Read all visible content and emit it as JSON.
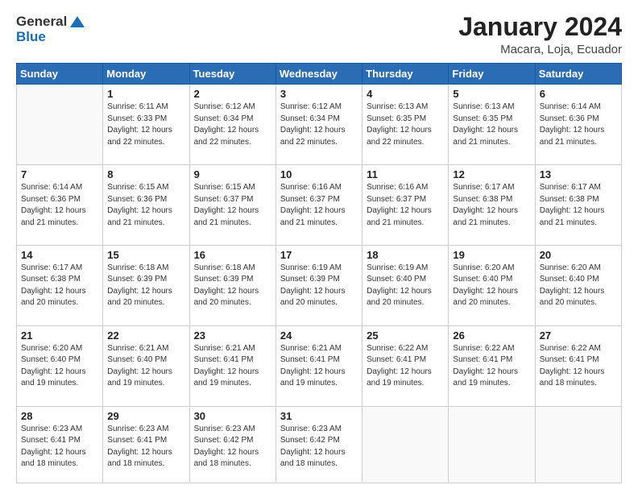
{
  "header": {
    "logo_general": "General",
    "logo_blue": "Blue",
    "month_title": "January 2024",
    "location": "Macara, Loja, Ecuador"
  },
  "weekdays": [
    "Sunday",
    "Monday",
    "Tuesday",
    "Wednesday",
    "Thursday",
    "Friday",
    "Saturday"
  ],
  "weeks": [
    [
      {
        "day": "",
        "info": ""
      },
      {
        "day": "1",
        "info": "Sunrise: 6:11 AM\nSunset: 6:33 PM\nDaylight: 12 hours\nand 22 minutes."
      },
      {
        "day": "2",
        "info": "Sunrise: 6:12 AM\nSunset: 6:34 PM\nDaylight: 12 hours\nand 22 minutes."
      },
      {
        "day": "3",
        "info": "Sunrise: 6:12 AM\nSunset: 6:34 PM\nDaylight: 12 hours\nand 22 minutes."
      },
      {
        "day": "4",
        "info": "Sunrise: 6:13 AM\nSunset: 6:35 PM\nDaylight: 12 hours\nand 22 minutes."
      },
      {
        "day": "5",
        "info": "Sunrise: 6:13 AM\nSunset: 6:35 PM\nDaylight: 12 hours\nand 21 minutes."
      },
      {
        "day": "6",
        "info": "Sunrise: 6:14 AM\nSunset: 6:36 PM\nDaylight: 12 hours\nand 21 minutes."
      }
    ],
    [
      {
        "day": "7",
        "info": ""
      },
      {
        "day": "8",
        "info": "Sunrise: 6:15 AM\nSunset: 6:36 PM\nDaylight: 12 hours\nand 21 minutes."
      },
      {
        "day": "9",
        "info": "Sunrise: 6:15 AM\nSunset: 6:37 PM\nDaylight: 12 hours\nand 21 minutes."
      },
      {
        "day": "10",
        "info": "Sunrise: 6:16 AM\nSunset: 6:37 PM\nDaylight: 12 hours\nand 21 minutes."
      },
      {
        "day": "11",
        "info": "Sunrise: 6:16 AM\nSunset: 6:37 PM\nDaylight: 12 hours\nand 21 minutes."
      },
      {
        "day": "12",
        "info": "Sunrise: 6:17 AM\nSunset: 6:38 PM\nDaylight: 12 hours\nand 21 minutes."
      },
      {
        "day": "13",
        "info": "Sunrise: 6:17 AM\nSunset: 6:38 PM\nDaylight: 12 hours\nand 21 minutes."
      }
    ],
    [
      {
        "day": "14",
        "info": ""
      },
      {
        "day": "15",
        "info": "Sunrise: 6:18 AM\nSunset: 6:39 PM\nDaylight: 12 hours\nand 20 minutes."
      },
      {
        "day": "16",
        "info": "Sunrise: 6:18 AM\nSunset: 6:39 PM\nDaylight: 12 hours\nand 20 minutes."
      },
      {
        "day": "17",
        "info": "Sunrise: 6:19 AM\nSunset: 6:39 PM\nDaylight: 12 hours\nand 20 minutes."
      },
      {
        "day": "18",
        "info": "Sunrise: 6:19 AM\nSunset: 6:40 PM\nDaylight: 12 hours\nand 20 minutes."
      },
      {
        "day": "19",
        "info": "Sunrise: 6:20 AM\nSunset: 6:40 PM\nDaylight: 12 hours\nand 20 minutes."
      },
      {
        "day": "20",
        "info": "Sunrise: 6:20 AM\nSunset: 6:40 PM\nDaylight: 12 hours\nand 20 minutes."
      }
    ],
    [
      {
        "day": "21",
        "info": ""
      },
      {
        "day": "22",
        "info": "Sunrise: 6:21 AM\nSunset: 6:40 PM\nDaylight: 12 hours\nand 19 minutes."
      },
      {
        "day": "23",
        "info": "Sunrise: 6:21 AM\nSunset: 6:41 PM\nDaylight: 12 hours\nand 19 minutes."
      },
      {
        "day": "24",
        "info": "Sunrise: 6:21 AM\nSunset: 6:41 PM\nDaylight: 12 hours\nand 19 minutes."
      },
      {
        "day": "25",
        "info": "Sunrise: 6:22 AM\nSunset: 6:41 PM\nDaylight: 12 hours\nand 19 minutes."
      },
      {
        "day": "26",
        "info": "Sunrise: 6:22 AM\nSunset: 6:41 PM\nDaylight: 12 hours\nand 19 minutes."
      },
      {
        "day": "27",
        "info": "Sunrise: 6:22 AM\nSunset: 6:41 PM\nDaylight: 12 hours\nand 18 minutes."
      }
    ],
    [
      {
        "day": "28",
        "info": "Sunrise: 6:23 AM\nSunset: 6:41 PM\nDaylight: 12 hours\nand 18 minutes."
      },
      {
        "day": "29",
        "info": "Sunrise: 6:23 AM\nSunset: 6:41 PM\nDaylight: 12 hours\nand 18 minutes."
      },
      {
        "day": "30",
        "info": "Sunrise: 6:23 AM\nSunset: 6:42 PM\nDaylight: 12 hours\nand 18 minutes."
      },
      {
        "day": "31",
        "info": "Sunrise: 6:23 AM\nSunset: 6:42 PM\nDaylight: 12 hours\nand 18 minutes."
      },
      {
        "day": "",
        "info": ""
      },
      {
        "day": "",
        "info": ""
      },
      {
        "day": "",
        "info": ""
      }
    ]
  ],
  "week1_day7_info": "Sunrise: 6:14 AM\nSunset: 6:36 PM\nDaylight: 12 hours\nand 21 minutes.",
  "week3_day14_info": "Sunrise: 6:17 AM\nSunset: 6:38 PM\nDaylight: 12 hours\nand 20 minutes.",
  "week4_day21_info": "Sunrise: 6:20 AM\nSunset: 6:40 PM\nDaylight: 12 hours\nand 19 minutes."
}
